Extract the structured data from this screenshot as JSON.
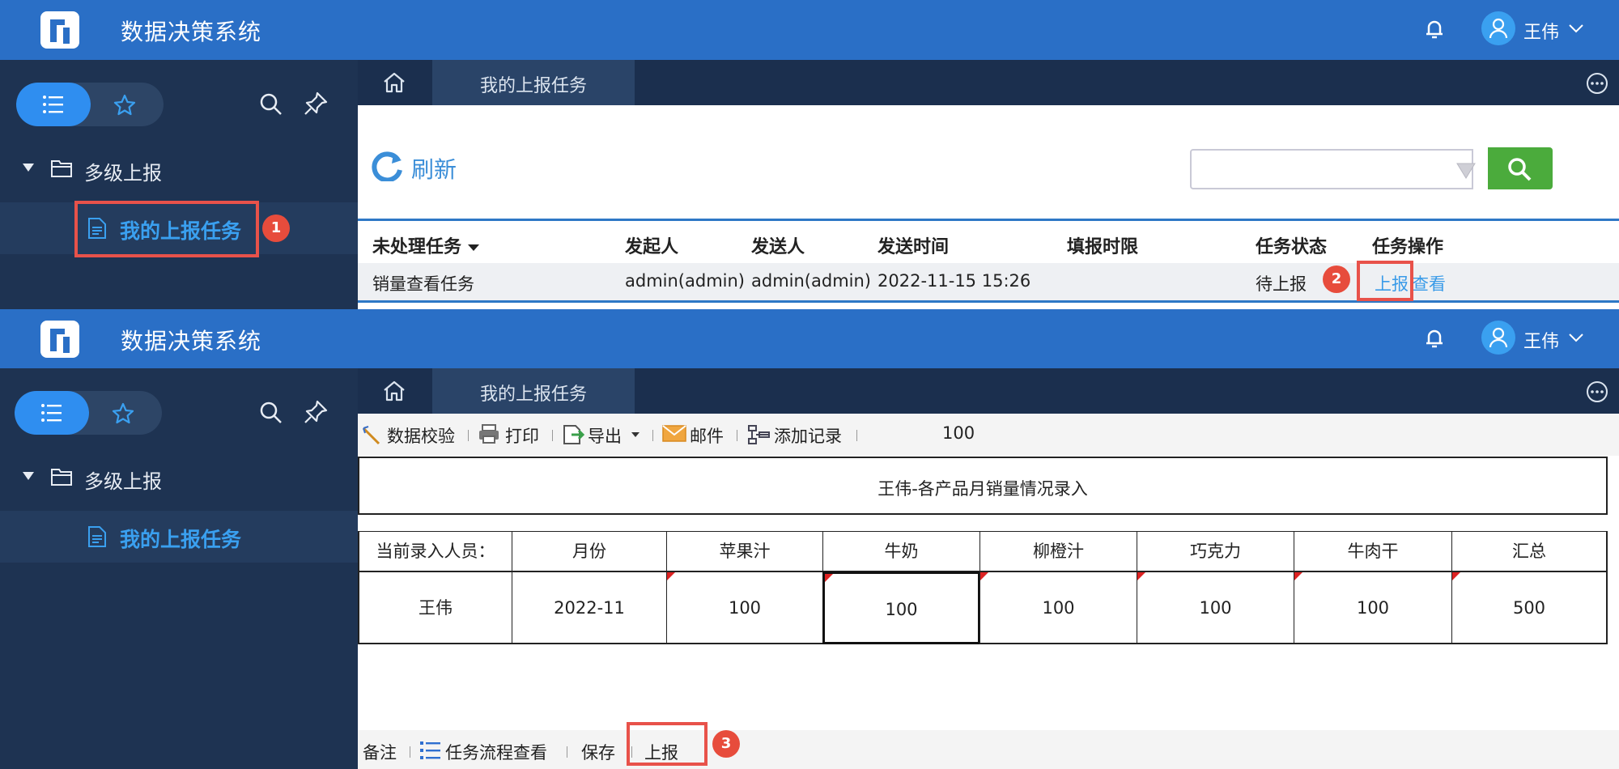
{
  "app": {
    "title": "数据决策系统",
    "user_name": "王伟",
    "colors": {
      "topbar": "#2a6fc6",
      "sidebar": "#1e3352",
      "accent": "#2f8ef0",
      "link": "#3a9be8",
      "highlight": "#e8524a",
      "search_green": "#4bab3c"
    }
  },
  "sidebar": {
    "folder_label": "多级上报",
    "task_label": "我的上报任务"
  },
  "tabs": {
    "active_label": "我的上报任务"
  },
  "task_list": {
    "refresh_label": "刷新",
    "columns": [
      "未处理任务",
      "发起人",
      "发送人",
      "发送时间",
      "填报时限",
      "任务状态",
      "任务操作"
    ],
    "row": {
      "task": "销量查看任务",
      "initiator": "admin(admin)",
      "sender": "admin(admin)",
      "send_time": "2022-11-15 15:26",
      "deadline": "",
      "status": "待上报",
      "op_report": "上报",
      "op_view": "查看"
    }
  },
  "toolbar": {
    "validate": "数据校验",
    "print": "打印",
    "export": "导出",
    "mail": "邮件",
    "add_record": "添加记录",
    "zoom": "100"
  },
  "form": {
    "title": "王伟-各产品月销量情况录入",
    "headers": [
      "当前录入人员：",
      "月份",
      "苹果汁",
      "牛奶",
      "柳橙汁",
      "巧克力",
      "牛肉干",
      "汇总"
    ],
    "values": [
      "王伟",
      "2022-11",
      "100",
      "100",
      "100",
      "100",
      "100",
      "500"
    ]
  },
  "bottom_toolbar": {
    "remark": "备注",
    "flow_view": "任务流程查看",
    "save": "保存",
    "submit": "上报"
  },
  "badges": {
    "b1": "1",
    "b2": "2",
    "b3": "3"
  }
}
